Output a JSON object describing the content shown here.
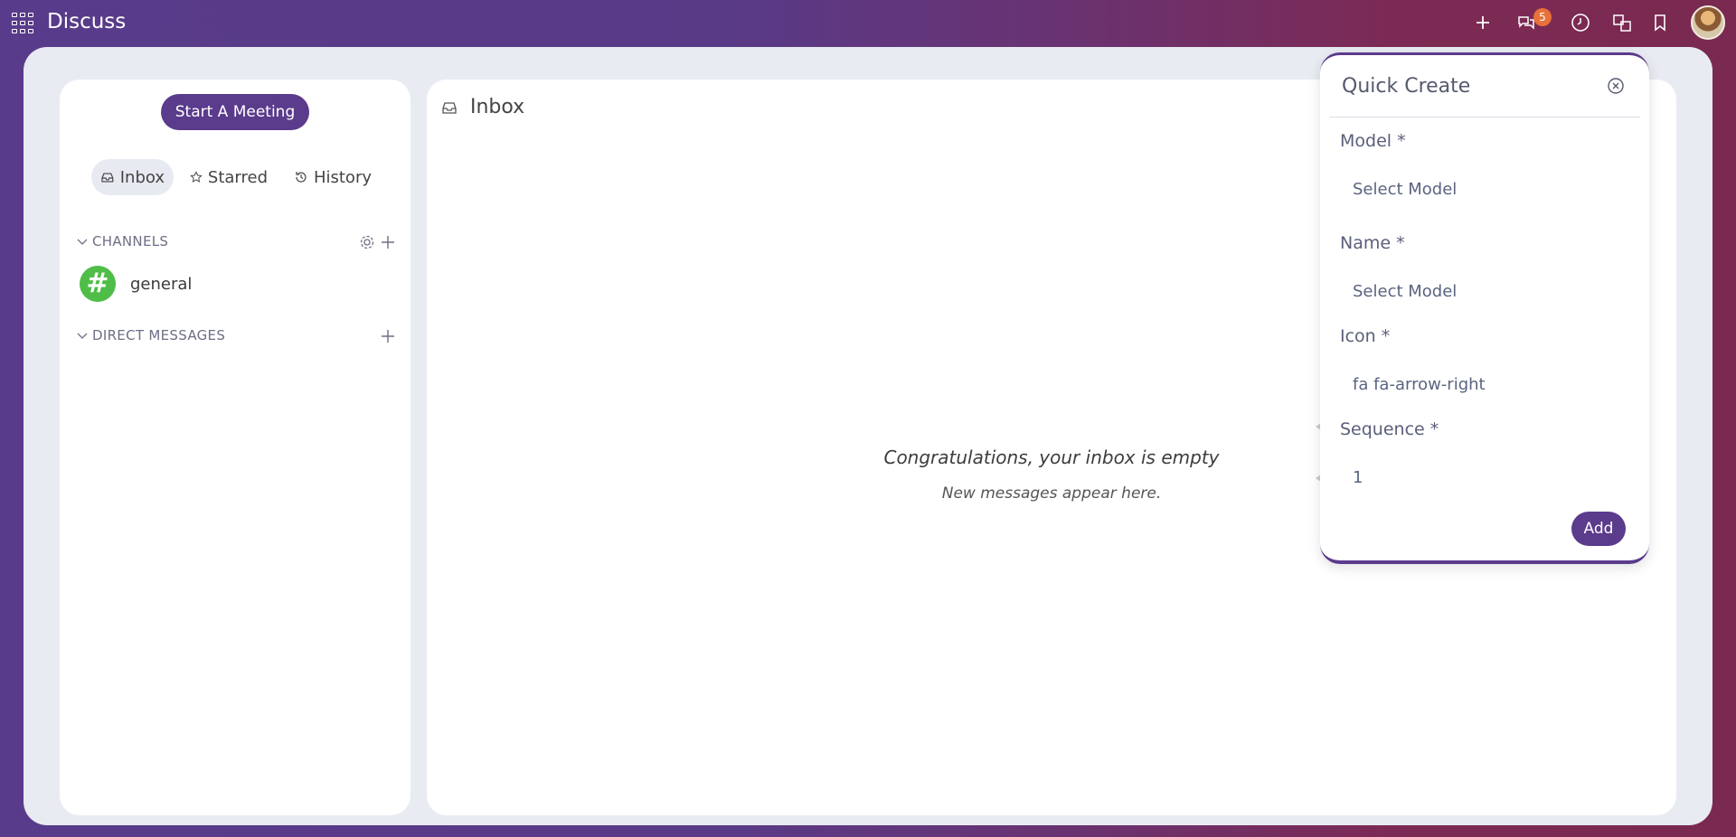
{
  "app": {
    "title": "Discuss"
  },
  "systray": {
    "message_count": "5"
  },
  "sidebar": {
    "meeting_button": "Start A Meeting",
    "tabs": [
      {
        "label": "Inbox",
        "icon": "inbox-icon",
        "active": true
      },
      {
        "label": "Starred",
        "icon": "star-icon",
        "active": false
      },
      {
        "label": "History",
        "icon": "history-icon",
        "active": false
      }
    ],
    "channels_header": "CHANNELS",
    "channels": [
      {
        "name": "general",
        "avatar_glyph": "#"
      }
    ],
    "direct_messages_header": "DIRECT MESSAGES"
  },
  "main": {
    "title": "Inbox",
    "empty_title": "Congratulations, your inbox is empty",
    "empty_subtitle": "New messages appear here."
  },
  "quick_create": {
    "title": "Quick Create",
    "fields": [
      {
        "label": "Model *",
        "placeholder": "Select Model",
        "value": ""
      },
      {
        "label": "Name *",
        "placeholder": "Select Model",
        "value": ""
      },
      {
        "label": "Icon *",
        "placeholder": "",
        "value": "fa fa-arrow-right"
      },
      {
        "label": "Sequence *",
        "placeholder": "",
        "value": "1"
      }
    ],
    "add_button": "Add"
  },
  "colors": {
    "accent": "#5b3b8c",
    "badge": "#e8713a",
    "channel_avatar": "#4fbd48"
  }
}
